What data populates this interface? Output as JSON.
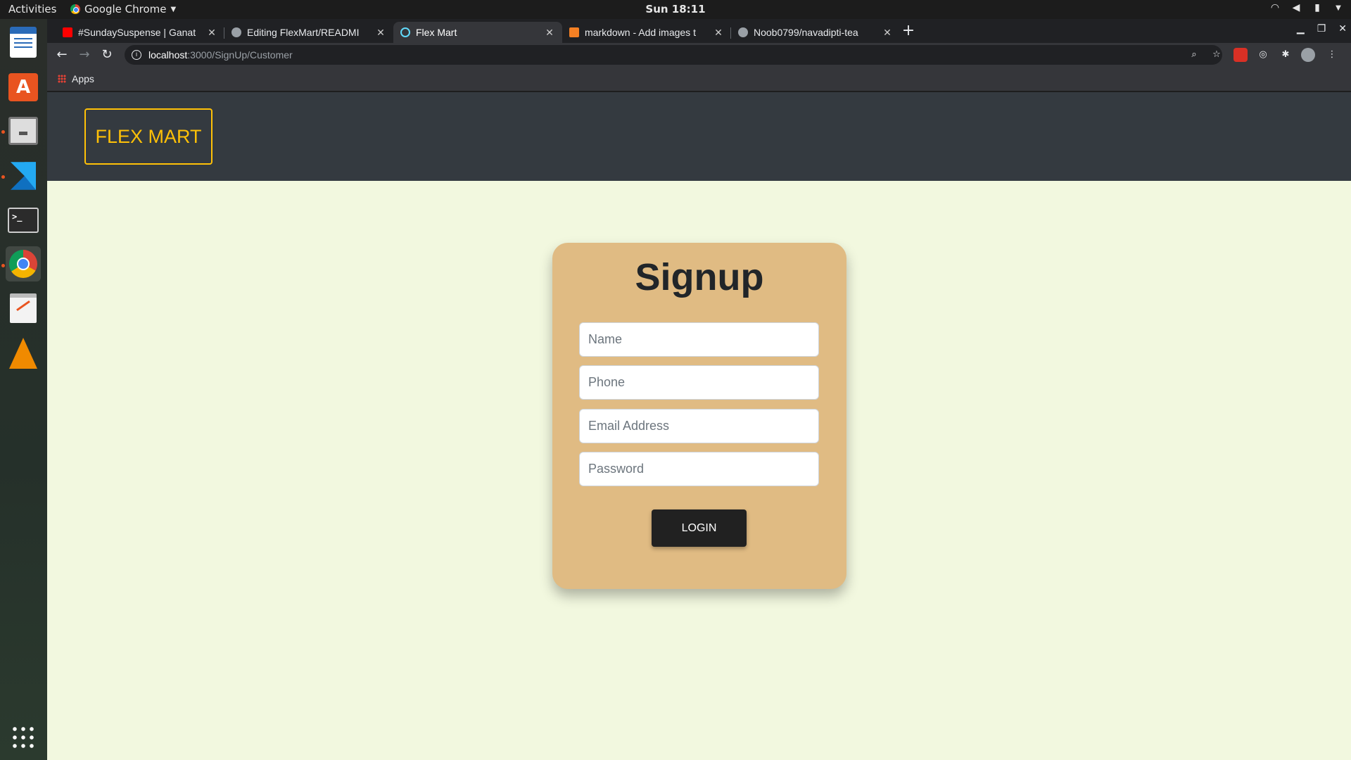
{
  "system": {
    "activities": "Activities",
    "app_name": "Google Chrome",
    "clock": "Sun 18:11"
  },
  "browser": {
    "tabs": [
      {
        "label": "#SundaySuspense | Ganat",
        "favicon_color": "#ff0000"
      },
      {
        "label": "Editing FlexMart/READMI",
        "favicon_color": "#9aa0a6"
      },
      {
        "label": "Flex Mart",
        "favicon_color": "#61dafb"
      },
      {
        "label": "markdown - Add images t",
        "favicon_color": "#f48024"
      },
      {
        "label": "Noob0799/navadipti-tea",
        "favicon_color": "#9aa0a6"
      }
    ],
    "url_host": "localhost",
    "url_path": ":3000/SignUp/Customer",
    "bookmarks": {
      "apps": "Apps"
    }
  },
  "page": {
    "brand": "FLEX MART",
    "title": "Signup",
    "fields": {
      "name_placeholder": "Name",
      "phone_placeholder": "Phone",
      "email_placeholder": "Email Address",
      "password_placeholder": "Password"
    },
    "login_label": "LOGIN"
  },
  "colors": {
    "navbar": "#343a40",
    "brand": "#ffc107",
    "page_bg": "#f2f8df",
    "card": "#e0bb83",
    "button": "#212121"
  }
}
